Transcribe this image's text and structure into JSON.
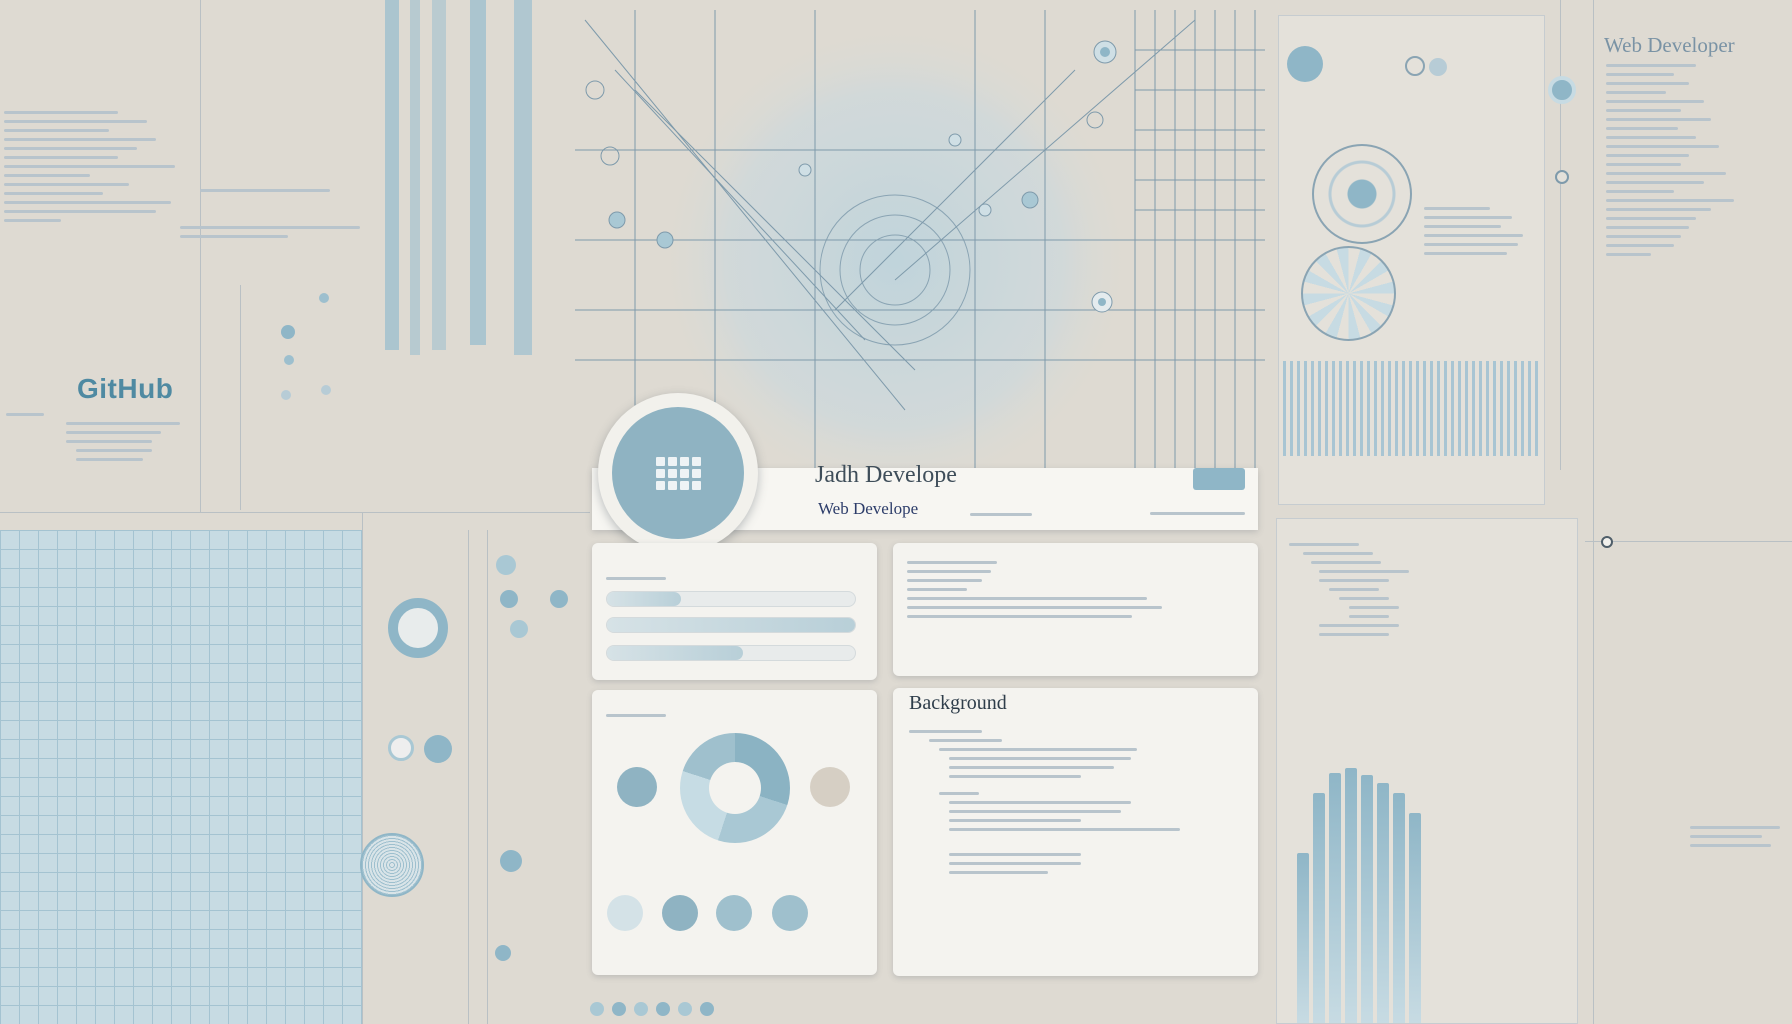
{
  "left_panel": {
    "github_label": "GitHub"
  },
  "profile": {
    "name": "Jadh Develope",
    "role": "Web Develope"
  },
  "side_panel": {
    "title": "Web Developer"
  },
  "background_card": {
    "title": "Background"
  },
  "colors": {
    "background": "#dedad2",
    "accent": "#8fb3c2",
    "card": "#f4f3ef",
    "text_dark": "#2e3d4a"
  },
  "icons": {
    "avatar": "grid-icon"
  }
}
